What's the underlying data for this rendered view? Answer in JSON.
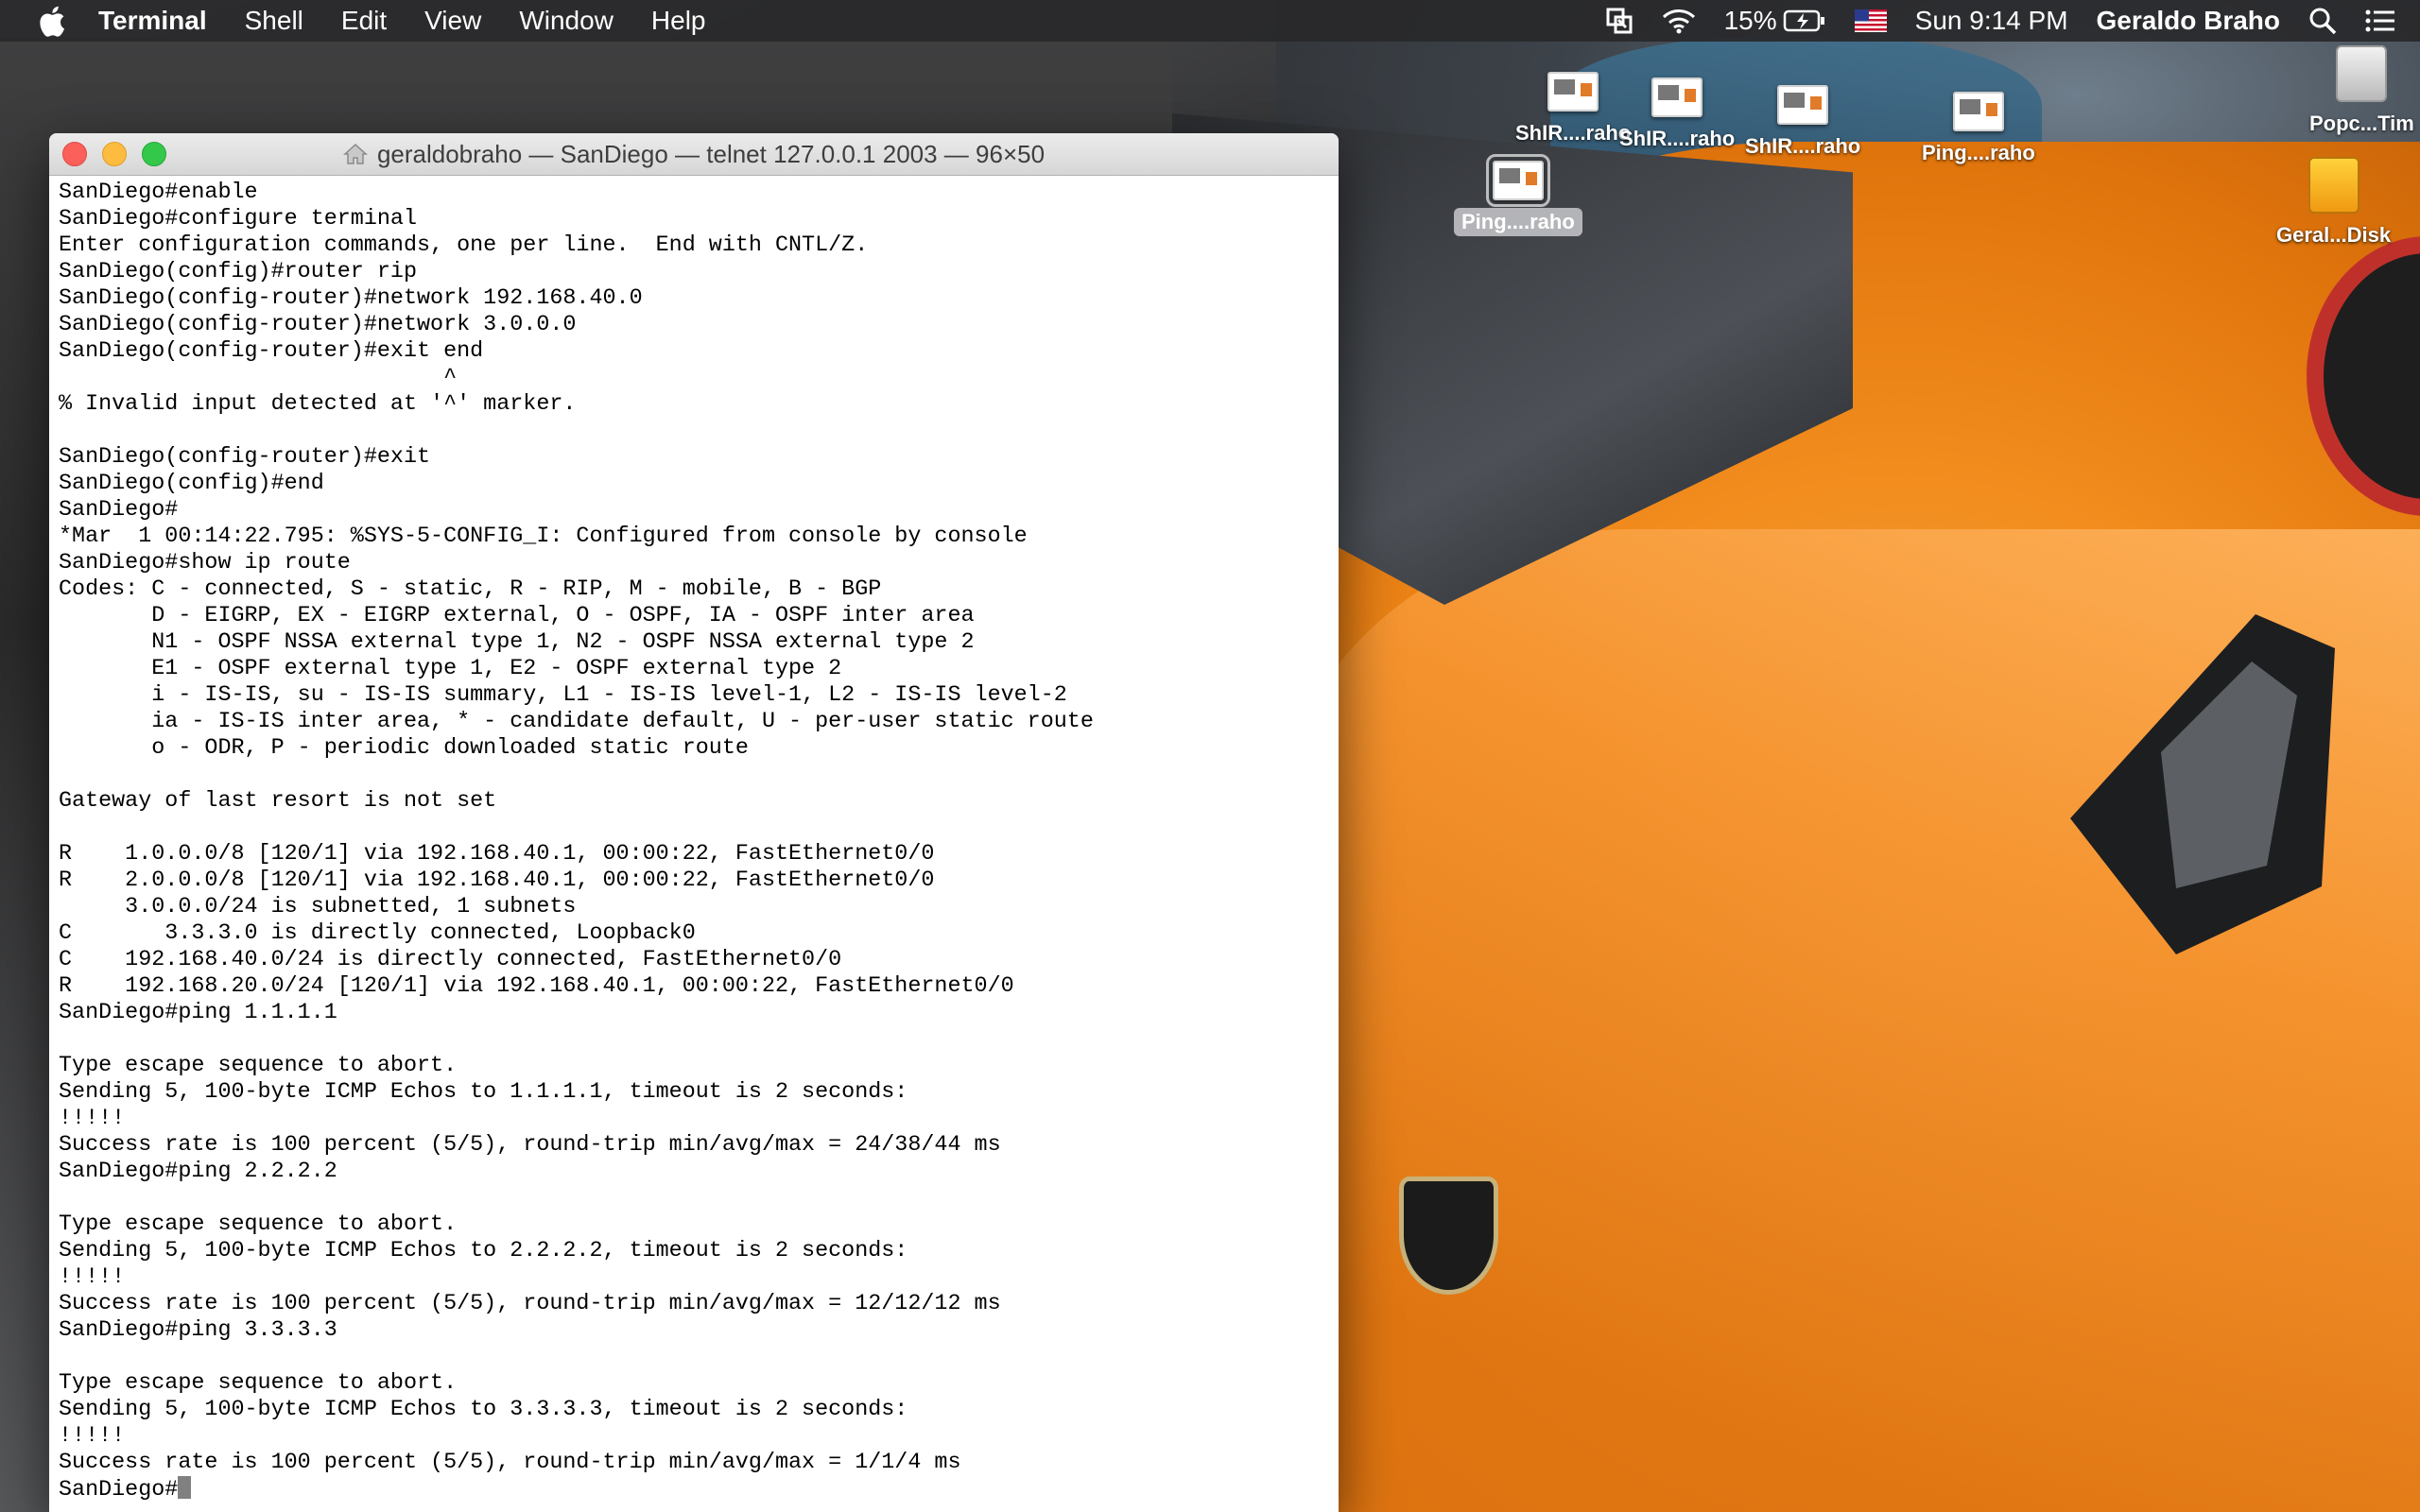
{
  "menubar": {
    "app_name": "Terminal",
    "items": [
      "Shell",
      "Edit",
      "View",
      "Window",
      "Help"
    ],
    "battery": "15%",
    "clock": "Sun 9:14 PM",
    "user": "Geraldo Braho"
  },
  "desktop": {
    "icons": [
      {
        "label": "ShIR....raho",
        "kind": "screenshot"
      },
      {
        "label": "ShIR....raho",
        "kind": "screenshot"
      },
      {
        "label": "ShIR....raho",
        "kind": "screenshot"
      },
      {
        "label": "Ping....raho",
        "kind": "screenshot"
      },
      {
        "label": "Ping....raho",
        "kind": "screenshot",
        "selected": true
      },
      {
        "label": "Popc...Tim",
        "kind": "disk-gray"
      },
      {
        "label": "Geral...Disk",
        "kind": "disk-orange"
      }
    ]
  },
  "terminal": {
    "title": "geraldobraho — SanDiego — telnet 127.0.0.1 2003 — 96×50",
    "lines": [
      "SanDiego#enable",
      "SanDiego#configure terminal",
      "Enter configuration commands, one per line.  End with CNTL/Z.",
      "SanDiego(config)#router rip",
      "SanDiego(config-router)#network 192.168.40.0",
      "SanDiego(config-router)#network 3.0.0.0",
      "SanDiego(config-router)#exit end",
      "                             ^",
      "% Invalid input detected at '^' marker.",
      "",
      "SanDiego(config-router)#exit",
      "SanDiego(config)#end",
      "SanDiego#",
      "*Mar  1 00:14:22.795: %SYS-5-CONFIG_I: Configured from console by console",
      "SanDiego#show ip route",
      "Codes: C - connected, S - static, R - RIP, M - mobile, B - BGP",
      "       D - EIGRP, EX - EIGRP external, O - OSPF, IA - OSPF inter area",
      "       N1 - OSPF NSSA external type 1, N2 - OSPF NSSA external type 2",
      "       E1 - OSPF external type 1, E2 - OSPF external type 2",
      "       i - IS-IS, su - IS-IS summary, L1 - IS-IS level-1, L2 - IS-IS level-2",
      "       ia - IS-IS inter area, * - candidate default, U - per-user static route",
      "       o - ODR, P - periodic downloaded static route",
      "",
      "Gateway of last resort is not set",
      "",
      "R    1.0.0.0/8 [120/1] via 192.168.40.1, 00:00:22, FastEthernet0/0",
      "R    2.0.0.0/8 [120/1] via 192.168.40.1, 00:00:22, FastEthernet0/0",
      "     3.0.0.0/24 is subnetted, 1 subnets",
      "C       3.3.3.0 is directly connected, Loopback0",
      "C    192.168.40.0/24 is directly connected, FastEthernet0/0",
      "R    192.168.20.0/24 [120/1] via 192.168.40.1, 00:00:22, FastEthernet0/0",
      "SanDiego#ping 1.1.1.1",
      "",
      "Type escape sequence to abort.",
      "Sending 5, 100-byte ICMP Echos to 1.1.1.1, timeout is 2 seconds:",
      "!!!!!",
      "Success rate is 100 percent (5/5), round-trip min/avg/max = 24/38/44 ms",
      "SanDiego#ping 2.2.2.2",
      "",
      "Type escape sequence to abort.",
      "Sending 5, 100-byte ICMP Echos to 2.2.2.2, timeout is 2 seconds:",
      "!!!!!",
      "Success rate is 100 percent (5/5), round-trip min/avg/max = 12/12/12 ms",
      "SanDiego#ping 3.3.3.3",
      "",
      "Type escape sequence to abort.",
      "Sending 5, 100-byte ICMP Echos to 3.3.3.3, timeout is 2 seconds:",
      "!!!!!",
      "Success rate is 100 percent (5/5), round-trip min/avg/max = 1/1/4 ms"
    ],
    "prompt": "SanDiego#"
  }
}
